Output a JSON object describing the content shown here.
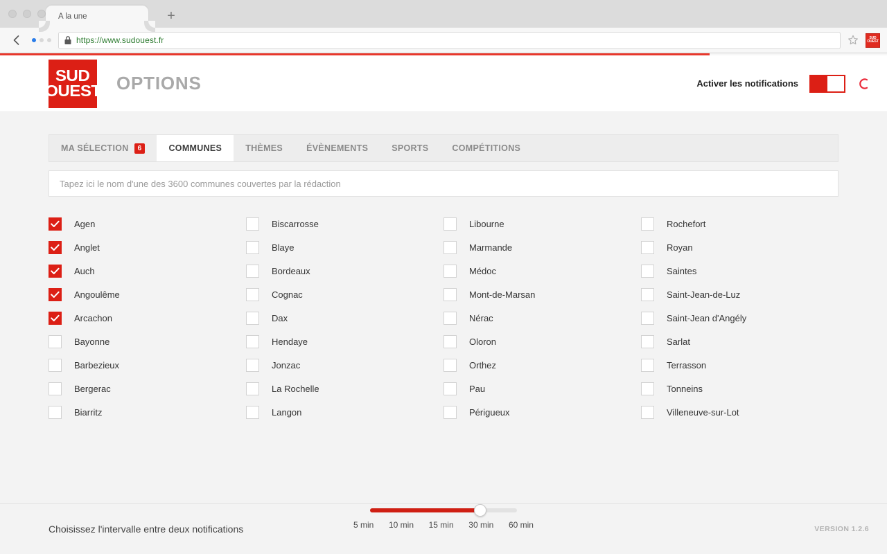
{
  "browser": {
    "tab_title": "A la une",
    "new_tab_label": "+",
    "back_label": "‹",
    "url": "https://www.sudouest.fr",
    "lock_icon": "lock-icon",
    "star_icon": "bookmark-star-icon",
    "extension_icon_line1": "SUD",
    "extension_icon_line2": "OUEST",
    "loading_progress_percent": 80
  },
  "header": {
    "logo_line1": "SUD",
    "logo_line2": "OUEST",
    "title": "OPTIONS",
    "notifications_label": "Activer les notifications",
    "toggle_state": "on",
    "spinner_icon": "loading-spinner-icon"
  },
  "tabs": [
    {
      "label": "MA SÉLECTION",
      "badge": "6",
      "active": false
    },
    {
      "label": "COMMUNES",
      "badge": "",
      "active": true
    },
    {
      "label": "THÈMES",
      "badge": "",
      "active": false
    },
    {
      "label": "ÉVÈNEMENTS",
      "badge": "",
      "active": false
    },
    {
      "label": "SPORTS",
      "badge": "",
      "active": false
    },
    {
      "label": "COMPÉTITIONS",
      "badge": "",
      "active": false
    }
  ],
  "search": {
    "placeholder": "Tapez ici le nom d'une des 3600 communes couvertes par la rédaction",
    "value": ""
  },
  "communes": {
    "columns": [
      [
        {
          "name": "Agen",
          "checked": true
        },
        {
          "name": "Anglet",
          "checked": true
        },
        {
          "name": "Auch",
          "checked": true
        },
        {
          "name": "Angoulême",
          "checked": true
        },
        {
          "name": "Arcachon",
          "checked": true
        },
        {
          "name": "Bayonne",
          "checked": false
        },
        {
          "name": "Barbezieux",
          "checked": false
        },
        {
          "name": "Bergerac",
          "checked": false
        },
        {
          "name": "Biarritz",
          "checked": false
        }
      ],
      [
        {
          "name": "Biscarrosse",
          "checked": false
        },
        {
          "name": "Blaye",
          "checked": false
        },
        {
          "name": "Bordeaux",
          "checked": false
        },
        {
          "name": "Cognac",
          "checked": false
        },
        {
          "name": "Dax",
          "checked": false
        },
        {
          "name": "Hendaye",
          "checked": false
        },
        {
          "name": "Jonzac",
          "checked": false
        },
        {
          "name": "La Rochelle",
          "checked": false
        },
        {
          "name": "Langon",
          "checked": false
        }
      ],
      [
        {
          "name": "Libourne",
          "checked": false
        },
        {
          "name": "Marmande",
          "checked": false
        },
        {
          "name": "Médoc",
          "checked": false
        },
        {
          "name": "Mont-de-Marsan",
          "checked": false
        },
        {
          "name": "Nérac",
          "checked": false
        },
        {
          "name": "Oloron",
          "checked": false
        },
        {
          "name": "Orthez",
          "checked": false
        },
        {
          "name": "Pau",
          "checked": false
        },
        {
          "name": "Périgueux",
          "checked": false
        }
      ],
      [
        {
          "name": "Rochefort",
          "checked": false
        },
        {
          "name": "Royan",
          "checked": false
        },
        {
          "name": "Saintes",
          "checked": false
        },
        {
          "name": "Saint-Jean-de-Luz",
          "checked": false
        },
        {
          "name": "Saint-Jean d'Angély",
          "checked": false
        },
        {
          "name": "Sarlat",
          "checked": false
        },
        {
          "name": "Terrasson",
          "checked": false
        },
        {
          "name": "Tonneins",
          "checked": false
        },
        {
          "name": "Villeneuve-sur-Lot",
          "checked": false
        }
      ]
    ]
  },
  "footer": {
    "interval_label": "Choisissez l'intervalle entre deux notifications",
    "slider_options": [
      "5 min",
      "10 min",
      "15 min",
      "30 min",
      "60 min"
    ],
    "slider_selected": "30 min",
    "slider_selected_index": 3,
    "version": "VERSION 1.2.6"
  },
  "colors": {
    "brand_red": "#dc1f15",
    "progress_red": "#e8372b",
    "page_bg": "#f3f3f3",
    "url_green": "#2f7d32"
  }
}
